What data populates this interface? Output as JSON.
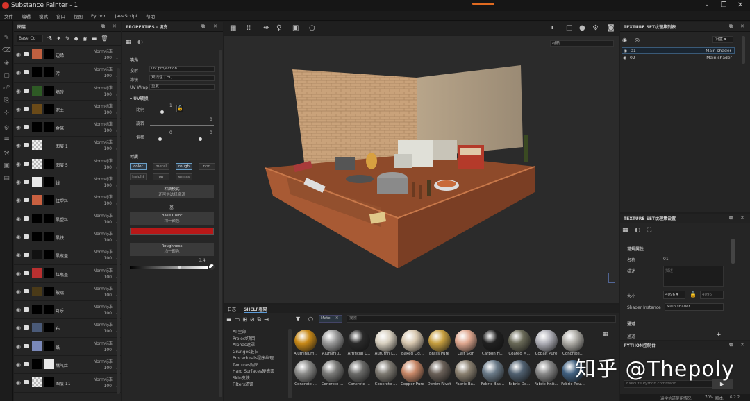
{
  "window": {
    "title": "Substance Painter - 1"
  },
  "menu": [
    "文件",
    "编辑",
    "模式",
    "窗口",
    "视图",
    "Python",
    "JavaScript",
    "帮助"
  ],
  "layers": {
    "title": "图层",
    "blend_mode": "Base Co",
    "rows": [
      {
        "name": "边缘",
        "blend": "Norm标准",
        "opacity": "100",
        "t1": "#c06040",
        "t2": "#000000"
      },
      {
        "name": "污",
        "blend": "Norm标准",
        "opacity": "100",
        "t1": "#000000",
        "t2": "#000000"
      },
      {
        "name": "墙砖",
        "blend": "Norm标准",
        "opacity": "100",
        "t1": "#2e5a25",
        "t2": "#000000"
      },
      {
        "name": "泥土",
        "blend": "Norm标准",
        "opacity": "100",
        "t1": "#6a4a18",
        "t2": "#000000"
      },
      {
        "name": "金属",
        "blend": "Norm标准",
        "opacity": "100",
        "t1": "#000000",
        "t2": "#000000"
      },
      {
        "name": "图层 1",
        "blend": "Norm标准",
        "opacity": "100",
        "t1": "checker",
        "t2": ""
      },
      {
        "name": "图层 5",
        "blend": "Norm标准",
        "opacity": "100",
        "t1": "checker",
        "t2": "#000000"
      },
      {
        "name": "线",
        "blend": "Norm标准",
        "opacity": "100",
        "t1": "#e8e8e8",
        "t2": "#000000"
      },
      {
        "name": "红塑料",
        "blend": "Norm标准",
        "opacity": "100",
        "t1": "#c86040",
        "t2": "#000000"
      },
      {
        "name": "黑塑料",
        "blend": "Norm标准",
        "opacity": "100",
        "t1": "#000000",
        "t2": "#000000"
      },
      {
        "name": "黑铁",
        "blend": "Norm标准",
        "opacity": "100",
        "t1": "#000000",
        "t2": "#000000"
      },
      {
        "name": "黑瓶盖",
        "blend": "Norm标准",
        "opacity": "100",
        "t1": "#111111",
        "t2": "#000000"
      },
      {
        "name": "红瓶盖",
        "blend": "Norm标准",
        "opacity": "100",
        "t1": "#b83030",
        "t2": "#000000"
      },
      {
        "name": "玻璃",
        "blend": "Norm标准",
        "opacity": "100",
        "t1": "#4a3a18",
        "t2": "#000000"
      },
      {
        "name": "可乐",
        "blend": "Norm标准",
        "opacity": "100",
        "t1": "#000000",
        "t2": "#000000"
      },
      {
        "name": "布",
        "blend": "Norm标准",
        "opacity": "100",
        "t1": "#4a5a78",
        "t2": "#000000"
      },
      {
        "name": "纸",
        "blend": "Norm标准",
        "opacity": "100",
        "t1": "#7a88b8",
        "t2": "#000000"
      },
      {
        "name": "燃气灶",
        "blend": "Norm标准",
        "opacity": "100",
        "t1": "#000000",
        "t2": "#e8e8e8"
      },
      {
        "name": "图层 11",
        "blend": "Norm标准",
        "opacity": "100",
        "t1": "checker",
        "t2": "#000000"
      }
    ]
  },
  "properties": {
    "title": "PROPERTIES - 填充",
    "fill_title": "填充",
    "projection_label": "投射",
    "projection_value": "UV projection",
    "filter_label": "滤镜",
    "filter_value": "双线性 | HQ",
    "uvwrap_label": "UV Wrap",
    "uvwrap_value": "重复",
    "uv_section": "UV转换",
    "scale_label": "比例",
    "scale_value": "1",
    "rotate_label": "旋转",
    "rotate_value": "0",
    "offset_label": "偏移",
    "offset_value": "0",
    "offset_value2": "0",
    "material_title": "材质",
    "chips": [
      "color",
      "metal",
      "rough",
      "nrm",
      "height",
      "op",
      "emiss"
    ],
    "material_mode_label": "材质模式",
    "material_mode_sub": "还可供选择资源",
    "base_title": "基",
    "base_color_label": "Base Color",
    "base_color_sub": "均一颜色",
    "base_color_hex": "#b81818",
    "roughness_label": "Roughness",
    "roughness_sub": "均一颜色",
    "roughness_value": "0.4"
  },
  "viewport": {
    "channel_select": "材质"
  },
  "shelf": {
    "tabs": [
      "日志",
      "SHELF着架"
    ],
    "filter_tag": "Mate⋯",
    "search_placeholder": "搜索",
    "categories": [
      "All全部",
      "Project项目",
      "Alphas遮罩",
      "Grunges脏旧",
      "Procedurals程序纹理",
      "Textures贴图",
      "Hard Surfaces硬表面",
      "Skin皮肤",
      "Filters滤镜"
    ],
    "materials": [
      {
        "name": "Aluminium...",
        "color": "#c98a18"
      },
      {
        "name": "Aluminiu...",
        "color": "#9a9a9a"
      },
      {
        "name": "Artificial L...",
        "color": "#2a2a2a"
      },
      {
        "name": "Autumn L...",
        "color": "#d8d0c0"
      },
      {
        "name": "Baked Lig...",
        "color": "#d8c8b0"
      },
      {
        "name": "Brass Pure",
        "color": "#c8a040"
      },
      {
        "name": "Calf Skin",
        "color": "#e0a890"
      },
      {
        "name": "Carbon Fi...",
        "color": "#202020"
      },
      {
        "name": "Coated M...",
        "color": "#6a6a58"
      },
      {
        "name": "Cobalt Pure",
        "color": "#b0b0b8"
      },
      {
        "name": "Concrete...",
        "color": "#b0aea8"
      },
      {
        "name": "Concrete ...",
        "color": "#8a8a88"
      },
      {
        "name": "Concrete ...",
        "color": "#7a7a78"
      },
      {
        "name": "Concrete ...",
        "color": "#6a6a68"
      },
      {
        "name": "Concrete ...",
        "color": "#7e7a72"
      },
      {
        "name": "Copper Pure",
        "color": "#c88868"
      },
      {
        "name": "Denim Rivet",
        "color": "#6a6058"
      },
      {
        "name": "Fabric Ba...",
        "color": "#8a8070"
      },
      {
        "name": "Fabric Bas...",
        "color": "#6a7a88"
      },
      {
        "name": "Fabric De...",
        "color": "#506070"
      },
      {
        "name": "Fabric Knit...",
        "color": "#888888"
      },
      {
        "name": "Fabric Rou...",
        "color": "#406080"
      }
    ]
  },
  "texture_sets": {
    "title": "TEXTURE SET纹理集列表",
    "settings_button": "设置",
    "rows": [
      {
        "name": "01",
        "shader": "Main shader"
      },
      {
        "name": "02",
        "shader": "Main shader"
      }
    ]
  },
  "texture_settings": {
    "title": "TEXTURE SET纹理集设置",
    "section": "常规属性",
    "name_label": "名称",
    "name_value": "01",
    "desc_label": "描述",
    "desc_placeholder": "描述",
    "size_label": "大小",
    "size_value": "4096",
    "size_value2": "4096",
    "shader_label": "Shader Instance",
    "shader_value": "Main shader",
    "channels_title": "通道",
    "channels_label": "通道"
  },
  "python": {
    "title": "PYTHON控制台",
    "placeholder": "Execute Python command"
  },
  "status": {
    "left": "遥学信道使用情况:",
    "percent": "70%",
    "version_label": "版本:",
    "version": "6.2.2"
  },
  "watermark": "知乎 @Thepoly"
}
